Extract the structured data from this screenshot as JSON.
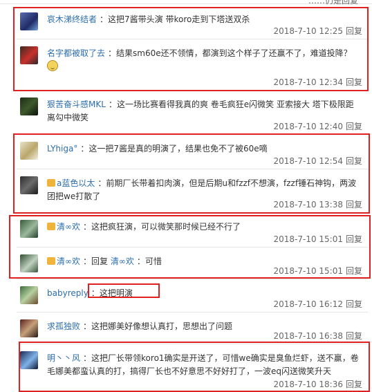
{
  "top": {
    "cut_text": "……仍是回复"
  },
  "comments": [
    {
      "user": "哀木涕终结者",
      "text": "这把7酱带头演 带koro走到下塔送双杀",
      "date": "2018-7-10 12:25",
      "reply": "回复"
    },
    {
      "user": "名字都被取了去",
      "text": "结果sm60e还不领情，都演到这个样子了还赢不了，难道投降？",
      "date": "2018-7-10 12:34",
      "reply": "回复"
    },
    {
      "user": "狠苦奋斗感MKL",
      "text": "这一场比赛看得我真的爽 卷毛疯狂e闪微笑 亚索接大 塔下极限距离勾中微笑",
      "date": "2018-7-10 12:40",
      "reply": "回复"
    },
    {
      "user": "LYhiga°",
      "text": "这一把7酱是真的明演了，结果也免不了被60e嘀",
      "date": "2018-7-10 12:54",
      "reply": "回复"
    },
    {
      "user": "a蓝色以太",
      "text": "前期厂长带着扣肉演，但是后期u和fzzf不想演，fzzf锤石神钩，两波团把we打散了",
      "date": "2018-7-10 13:38",
      "reply": "回复"
    },
    {
      "user": "清∞欢",
      "text": "这把疯狂演，可以微笑那时候已经不行了",
      "date": "2018-7-10 15:01",
      "reply": "回复"
    },
    {
      "user": "清∞欢",
      "reply_prefix": "回复",
      "reply_target": "清∞欢",
      "text": "可惜",
      "date": "2018-7-10 15:01",
      "reply": "回复"
    },
    {
      "user": "babyreply",
      "text": "这把明演",
      "date": "2018-7-10 16:12",
      "reply": "回复"
    },
    {
      "user": "求孤独败",
      "text": "这把娜美好像想认真打，思想出了问题",
      "date": "2018-7-10 16:38",
      "reply": "回复"
    },
    {
      "user": "明丶丶风",
      "text": "这把厂长带领koro1确实是开送了，可惜we确实是臭鱼烂虾，送不赢，卷毛娜美都蛮认真的打，搞得厂长也不好意思不好好打了，一波eq闪送微笑升天",
      "date": "2018-7-10 18:36",
      "reply": "回复"
    }
  ],
  "colors": {
    "username": "#2b6dad",
    "highlight": "#e02020",
    "meta": "#666666"
  }
}
